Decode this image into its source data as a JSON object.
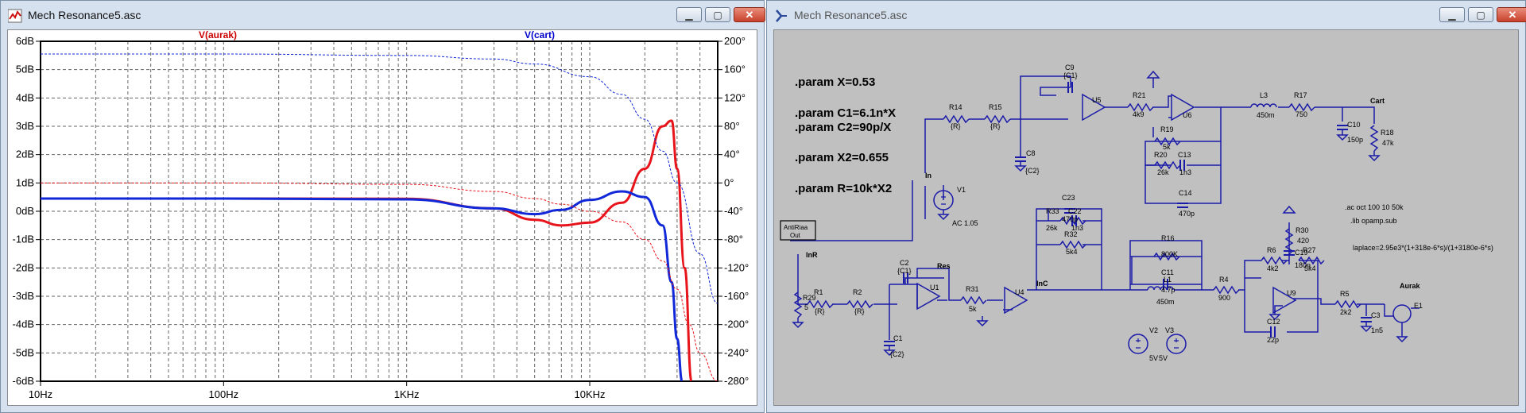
{
  "plot_window": {
    "title": "Mech Resonance5.asc",
    "legend_left": "V(aurak)",
    "legend_right": "V(cart)",
    "left_ticks": [
      "6dB",
      "5dB",
      "4dB",
      "3dB",
      "2dB",
      "1dB",
      "0dB",
      "-1dB",
      "-2dB",
      "-3dB",
      "-4dB",
      "-5dB",
      "-6dB"
    ],
    "right_ticks": [
      "200°",
      "160°",
      "120°",
      "80°",
      "40°",
      "0°",
      "-40°",
      "-80°",
      "-120°",
      "-160°",
      "-200°",
      "-240°",
      "-280°"
    ],
    "x_ticks": [
      "10Hz",
      "100Hz",
      "1KHz",
      "10KHz"
    ]
  },
  "schematic_window": {
    "title": "Mech Resonance5.asc",
    "params": [
      ".param X=0.53",
      ".param C1=6.1n*X",
      ".param C2=90p/X",
      ".param X2=0.655",
      ".param R=10k*X2"
    ],
    "directives": [
      ".ac oct 100 10 50k",
      ".lib opamp.sub",
      "laplace=2.95e3*(1+318e-6*s)/(1+3180e-6*s)"
    ],
    "labels": {
      "antiriaa": "AntiRiaa",
      "out": "Out",
      "inr": "InR",
      "res": "Res",
      "inc": "InC",
      "in": "In",
      "cart": "Cart",
      "aurak": "Aurak",
      "ac": "AC 1.05",
      "v2v": "5V",
      "v3v": "5V",
      "c9": "C9",
      "c9v": "{C1}",
      "r14": "R14",
      "r14v": "{R}",
      "r15": "R15",
      "r15v": "{R}",
      "u5": "U5",
      "c8": "C8",
      "c8v": "{C2}",
      "r21": "R21",
      "r21v": "4k9",
      "u6": "U6",
      "r19": "R19",
      "r19v": "5k",
      "r20": "R20",
      "r20v": "26k",
      "c13": "C13",
      "c13v": "1n3",
      "c14": "C14",
      "c14v": "470p",
      "l3": "L3",
      "l3v": "450m",
      "r17": "R17",
      "r17v": "750",
      "c10": "C10",
      "c10v": "150p",
      "r18": "R18",
      "r18v": "47k",
      "v1": "V1",
      "c23": "C23",
      "c23v": "470p",
      "r33": "R33",
      "r33v": "26k",
      "c22": "C22",
      "c22v": "1n3",
      "r32": "R32",
      "r32v": "5k4",
      "c2": "C2",
      "c2v": "{C1}",
      "r1": "R1",
      "r1v": "{R}",
      "r2": "R2",
      "r2v": "{R}",
      "u1": "U1",
      "c1": "C1",
      "c1v": "{C2}",
      "r29": "R29",
      "r29v": "5",
      "r31": "R31",
      "r31v": "5k",
      "u4": "U4",
      "r16": "R16",
      "r16v": "800K",
      "c11": "C11",
      "c11v": "4.7p",
      "l1": "L1",
      "l1v": "450m",
      "r4": "R4",
      "r4v": "900",
      "v2": "V2",
      "v3": "V3",
      "r30": "R30",
      "r30v": "420",
      "c19": "C19",
      "c19v": "180n",
      "r6": "R6",
      "r6v": "4k2",
      "r27": "R27",
      "r27v": "5k4",
      "u9": "U9",
      "c12": "C12",
      "c12v": "22p",
      "r5": "R5",
      "r5v": "2k2",
      "c3": "C3",
      "c3v": "1n5",
      "e1": "E1"
    }
  },
  "colors": {
    "aurak": "#e8141b",
    "cart": "#1028d8",
    "legend_aurak": "#cc0000",
    "legend_cart": "#0000cc",
    "wire": "#1a1aa8",
    "schematic_bg": "#c0c0c0"
  },
  "chart_data": {
    "type": "line",
    "title": "",
    "xlabel": "",
    "ylabel": "",
    "xscale": "log",
    "xlim": [
      10,
      50000
    ],
    "ylim": [
      -6,
      6
    ],
    "y2lim": [
      -280,
      200
    ],
    "grid": true,
    "legend": "top",
    "series": [
      {
        "name": "V(aurak)",
        "style": "magnitude",
        "x": [
          10,
          100,
          1000,
          3000,
          5000,
          7000,
          10000,
          15000,
          20000,
          25000,
          28000,
          30000,
          33000,
          36000
        ],
        "y": [
          0.45,
          0.45,
          0.44,
          0.1,
          -0.3,
          -0.5,
          -0.4,
          0.3,
          1.5,
          3.0,
          3.2,
          1.5,
          -2.0,
          -6.0
        ]
      },
      {
        "name": "V(cart)",
        "style": "magnitude",
        "x": [
          10,
          100,
          1000,
          3000,
          5000,
          7000,
          10000,
          15000,
          20000,
          25000,
          28000,
          30000,
          32000
        ],
        "y": [
          0.45,
          0.45,
          0.42,
          0.1,
          -0.1,
          0.05,
          0.4,
          0.7,
          0.5,
          -0.5,
          -2.5,
          -4.5,
          -6.0
        ]
      },
      {
        "name": "V(aurak)",
        "style": "phase",
        "x": [
          10,
          100,
          1000,
          3000,
          5000,
          7000,
          10000,
          15000,
          20000,
          25000,
          30000,
          35000,
          40000,
          50000
        ],
        "y": [
          0,
          0,
          -2,
          -12,
          -22,
          -30,
          -40,
          -55,
          -80,
          -110,
          -150,
          -200,
          -240,
          -280
        ]
      },
      {
        "name": "V(cart)",
        "style": "phase",
        "x": [
          10,
          100,
          1000,
          3000,
          5000,
          10000,
          15000,
          20000,
          25000,
          30000,
          40000,
          50000
        ],
        "y": [
          182,
          182,
          180,
          175,
          168,
          150,
          125,
          90,
          45,
          0,
          -100,
          -170
        ]
      }
    ]
  }
}
